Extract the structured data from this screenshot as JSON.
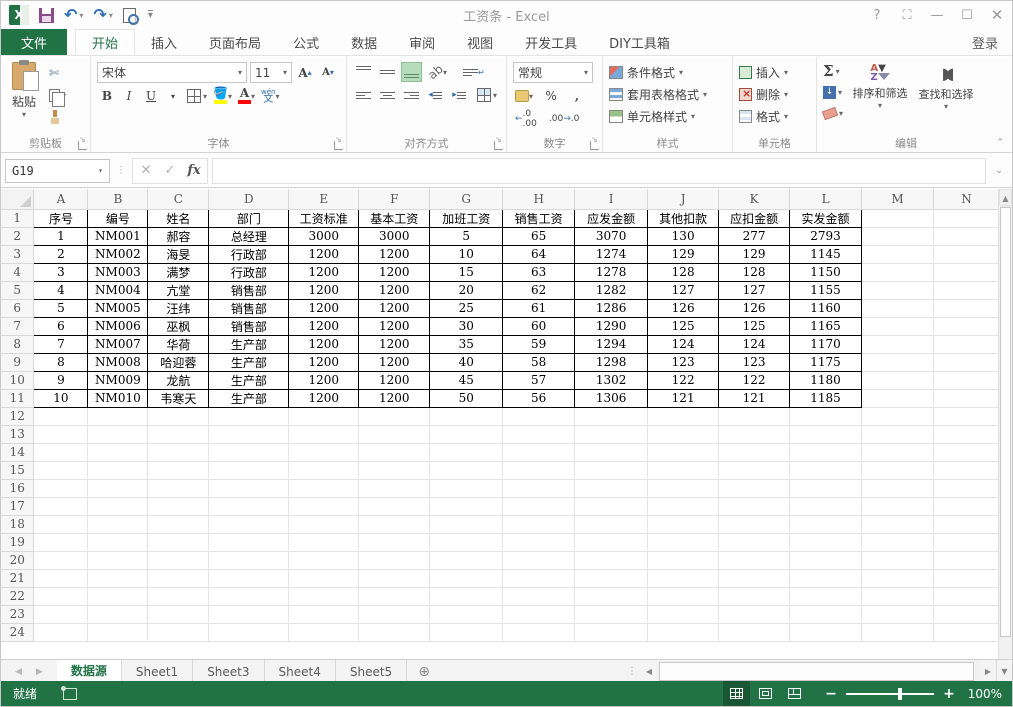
{
  "window": {
    "title": "工资条 - Excel",
    "help": "?",
    "signin": "登录"
  },
  "quick_access": {
    "icons": [
      "excel-logo",
      "save",
      "undo",
      "redo",
      "print-preview",
      "customize-quick-access"
    ]
  },
  "ribbon_tabs": {
    "file": "文件",
    "items": [
      "开始",
      "插入",
      "页面布局",
      "公式",
      "数据",
      "审阅",
      "视图",
      "开发工具",
      "DIY工具箱"
    ],
    "active": "开始"
  },
  "ribbon": {
    "clipboard": {
      "label": "剪贴板",
      "paste": "粘贴"
    },
    "font": {
      "label": "字体",
      "name": "宋体",
      "size": "11",
      "bold": "B",
      "italic": "I",
      "underline": "U",
      "phonetic_top": "wén",
      "phonetic_bottom": "文"
    },
    "alignment": {
      "label": "对齐方式"
    },
    "number": {
      "label": "数字",
      "format": "常规",
      "percent": "%",
      "comma": ",",
      "dec_inc": "←.0 .00",
      "dec_dec": ".00 →.0"
    },
    "styles": {
      "label": "样式",
      "items": [
        "条件格式",
        "套用表格格式",
        "单元格样式"
      ]
    },
    "cells": {
      "label": "单元格",
      "items": [
        "插入",
        "删除",
        "格式"
      ]
    },
    "editing": {
      "label": "编辑",
      "autosum": "Σ",
      "sort_filter": "排序和筛选",
      "find_select": "查找和选择"
    }
  },
  "formula_bar": {
    "name_box": "G19",
    "fx": "fx",
    "value": ""
  },
  "grid": {
    "column_letters": [
      "A",
      "B",
      "C",
      "D",
      "E",
      "F",
      "G",
      "H",
      "I",
      "J",
      "K",
      "L",
      "M",
      "N"
    ],
    "row_count": 24,
    "table": {
      "headers": [
        "序号",
        "编号",
        "姓名",
        "部门",
        "工资标准",
        "基本工资",
        "加班工资",
        "销售工资",
        "应发金额",
        "其他扣款",
        "应扣金额",
        "实发金额"
      ],
      "rows": [
        [
          "1",
          "NM001",
          "郝容",
          "总经理",
          "3000",
          "3000",
          "5",
          "65",
          "3070",
          "130",
          "277",
          "2793"
        ],
        [
          "2",
          "NM002",
          "海旻",
          "行政部",
          "1200",
          "1200",
          "10",
          "64",
          "1274",
          "129",
          "129",
          "1145"
        ],
        [
          "3",
          "NM003",
          "满梦",
          "行政部",
          "1200",
          "1200",
          "15",
          "63",
          "1278",
          "128",
          "128",
          "1150"
        ],
        [
          "4",
          "NM004",
          "亢堂",
          "销售部",
          "1200",
          "1200",
          "20",
          "62",
          "1282",
          "127",
          "127",
          "1155"
        ],
        [
          "5",
          "NM005",
          "汪纬",
          "销售部",
          "1200",
          "1200",
          "25",
          "61",
          "1286",
          "126",
          "126",
          "1160"
        ],
        [
          "6",
          "NM006",
          "巫枫",
          "销售部",
          "1200",
          "1200",
          "30",
          "60",
          "1290",
          "125",
          "125",
          "1165"
        ],
        [
          "7",
          "NM007",
          "华荷",
          "生产部",
          "1200",
          "1200",
          "35",
          "59",
          "1294",
          "124",
          "124",
          "1170"
        ],
        [
          "8",
          "NM008",
          "哈迎蓉",
          "生产部",
          "1200",
          "1200",
          "40",
          "58",
          "1298",
          "123",
          "123",
          "1175"
        ],
        [
          "9",
          "NM009",
          "龙航",
          "生产部",
          "1200",
          "1200",
          "45",
          "57",
          "1302",
          "122",
          "122",
          "1180"
        ],
        [
          "10",
          "NM010",
          "韦寒天",
          "生产部",
          "1200",
          "1200",
          "50",
          "56",
          "1306",
          "121",
          "121",
          "1185"
        ]
      ]
    }
  },
  "sheet_tabs": {
    "items": [
      "数据源",
      "Sheet1",
      "Sheet3",
      "Sheet4",
      "Sheet5"
    ],
    "active": "数据源"
  },
  "status_bar": {
    "mode": "就绪",
    "zoom_level": "100%"
  },
  "colors": {
    "accent_green": "#217346",
    "fill_color_swatch": "#ffff00",
    "font_color_swatch": "#ff0000",
    "active_button_green": "#b7dcbb"
  }
}
